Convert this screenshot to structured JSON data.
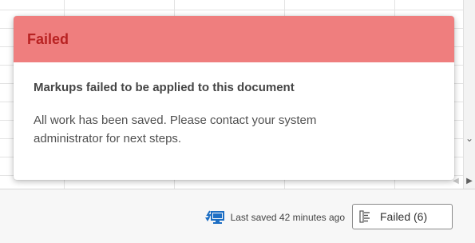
{
  "notification": {
    "title": "Failed",
    "heading": "Markups failed to be applied to this document",
    "message": "All work has been saved. Please contact your system administrator for next steps."
  },
  "status_bar": {
    "save_status": "Last saved 42 minutes ago",
    "failed_button_label": "Failed (6)"
  },
  "scrollbar": {
    "down_arrow": "⌄",
    "left_arrow": "◀",
    "right_arrow": "▶"
  },
  "icons": {
    "save_status_icon": "sync-icon",
    "failed_button_icon": "document-list-icon"
  },
  "colors": {
    "header_bg": "#ef7e7e",
    "title_text": "#b82222",
    "icon_blue": "#1e6fc4"
  }
}
